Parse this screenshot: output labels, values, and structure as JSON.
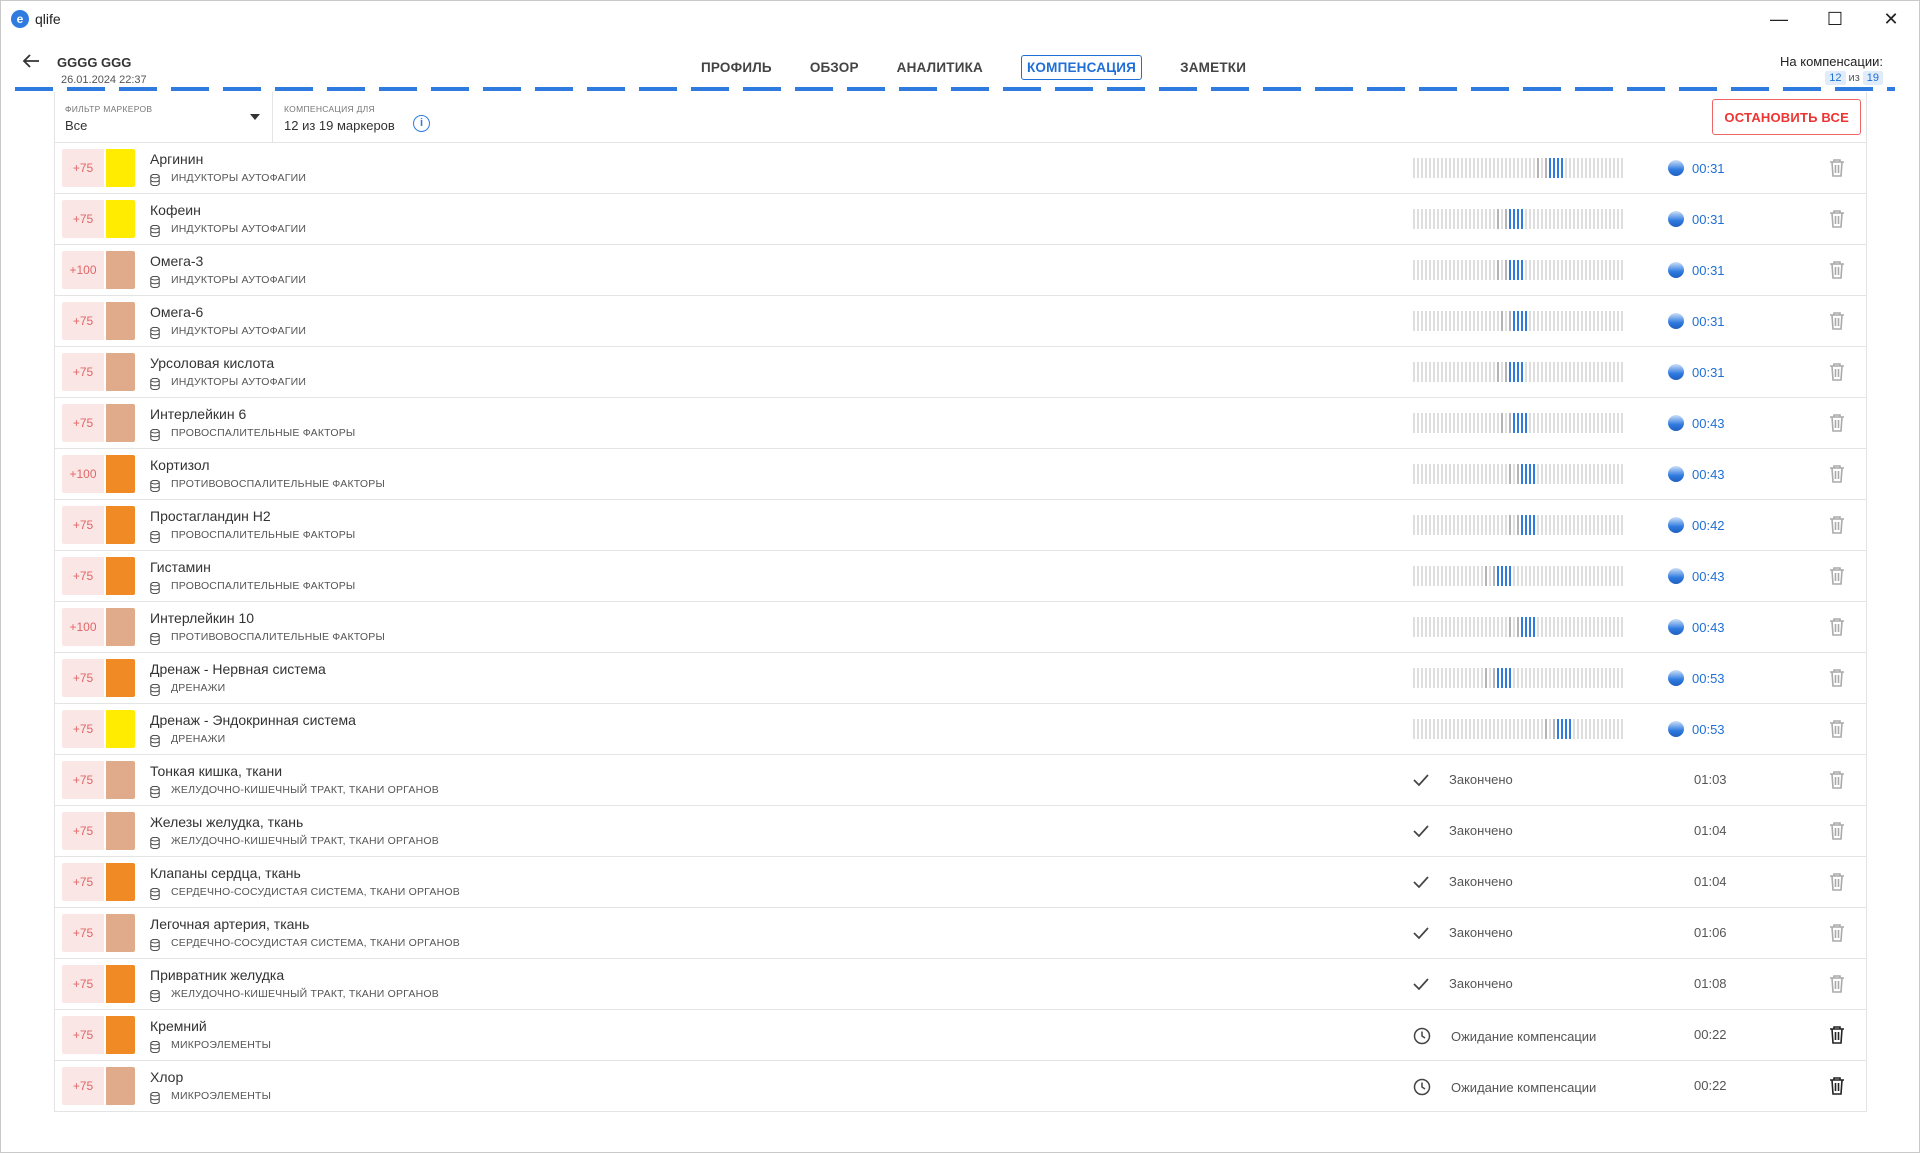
{
  "app": {
    "title": "qlife",
    "logo": "e"
  },
  "window": {
    "minimize": "—",
    "maximize": "☐",
    "close": "✕"
  },
  "patient": {
    "name": "GGGG GGG",
    "date": "26.01.2024 22:37"
  },
  "tabs": [
    {
      "label": "ПРОФИЛЬ",
      "active": false
    },
    {
      "label": "ОБЗОР",
      "active": false
    },
    {
      "label": "АНАЛИТИКА",
      "active": false
    },
    {
      "label": "КОМПЕНСАЦИЯ",
      "active": true
    },
    {
      "label": "ЗАМЕТКИ",
      "active": false
    }
  ],
  "compensation": {
    "label": "На компенсации:",
    "current": "12",
    "of": "из",
    "total": "19"
  },
  "filter": {
    "caption": "ФИЛЬТР МАРКЕРОВ",
    "value": "Все",
    "comp_caption": "КОМПЕНСАЦИЯ ДЛЯ",
    "comp_value": "12 из 19 маркеров",
    "stop_all": "ОСТАНОВИТЬ ВСЕ"
  },
  "colors": {
    "accent": "#1f6fd6",
    "yellow": "#ffec00",
    "tan": "#e0ab8a",
    "orange": "#f08a24",
    "stop": "#e33333"
  },
  "rows": [
    {
      "points": "+75",
      "color": "#ffec00",
      "name": "Аргинин",
      "category": "ИНДУКТОРЫ АУТОФАГИИ",
      "state": "running",
      "pos": 0.65,
      "time": "00:31"
    },
    {
      "points": "+75",
      "color": "#ffec00",
      "name": "Кофеин",
      "category": "ИНДУКТОРЫ АУТОФАГИИ",
      "state": "running",
      "pos": 0.45,
      "time": "00:31"
    },
    {
      "points": "+100",
      "color": "#e0ab8a",
      "name": "Омега-3",
      "category": "ИНДУКТОРЫ АУТОФАГИИ",
      "state": "running",
      "pos": 0.45,
      "time": "00:31"
    },
    {
      "points": "+75",
      "color": "#e0ab8a",
      "name": "Омега-6",
      "category": "ИНДУКТОРЫ АУТОФАГИИ",
      "state": "running",
      "pos": 0.48,
      "time": "00:31"
    },
    {
      "points": "+75",
      "color": "#e0ab8a",
      "name": "Урсоловая кислота",
      "category": "ИНДУКТОРЫ АУТОФАГИИ",
      "state": "running",
      "pos": 0.45,
      "time": "00:31"
    },
    {
      "points": "+75",
      "color": "#e0ab8a",
      "name": "Интерлейкин 6",
      "category": "ПРОВОСПАЛИТЕЛЬНЫЕ ФАКТОРЫ",
      "state": "running",
      "pos": 0.48,
      "time": "00:43"
    },
    {
      "points": "+100",
      "color": "#f08a24",
      "name": "Кортизол",
      "category": "ПРОТИВОВОСПАЛИТЕЛЬНЫЕ ФАКТОРЫ",
      "state": "running",
      "pos": 0.51,
      "time": "00:43"
    },
    {
      "points": "+75",
      "color": "#f08a24",
      "name": "Простагландин Н2",
      "category": "ПРОВОСПАЛИТЕЛЬНЫЕ ФАКТОРЫ",
      "state": "running",
      "pos": 0.51,
      "time": "00:42"
    },
    {
      "points": "+75",
      "color": "#f08a24",
      "name": "Гистамин",
      "category": "ПРОВОСПАЛИТЕЛЬНЫЕ ФАКТОРЫ",
      "state": "running",
      "pos": 0.4,
      "time": "00:43"
    },
    {
      "points": "+100",
      "color": "#e0ab8a",
      "name": "Интерлейкин 10",
      "category": "ПРОТИВОВОСПАЛИТЕЛЬНЫЕ ФАКТОРЫ",
      "state": "running",
      "pos": 0.51,
      "time": "00:43"
    },
    {
      "points": "+75",
      "color": "#f08a24",
      "name": "Дренаж - Нервная система",
      "category": "ДРЕНАЖИ",
      "state": "running",
      "pos": 0.4,
      "time": "00:53"
    },
    {
      "points": "+75",
      "color": "#ffec00",
      "name": "Дренаж - Эндокринная система",
      "category": "ДРЕНАЖИ",
      "state": "running",
      "pos": 0.67,
      "time": "00:53"
    },
    {
      "points": "+75",
      "color": "#e0ab8a",
      "name": "Тонкая кишка, ткани",
      "category": "ЖЕЛУДОЧНО-КИШЕЧНЫЙ ТРАКТ, ТКАНИ ОРГАНОВ",
      "state": "done",
      "status": "Закончено",
      "time": "01:03"
    },
    {
      "points": "+75",
      "color": "#e0ab8a",
      "name": "Железы желудка, ткань",
      "category": "ЖЕЛУДОЧНО-КИШЕЧНЫЙ ТРАКТ, ТКАНИ ОРГАНОВ",
      "state": "done",
      "status": "Закончено",
      "time": "01:04"
    },
    {
      "points": "+75",
      "color": "#f08a24",
      "name": "Клапаны сердца, ткань",
      "category": "СЕРДЕЧНО-СОСУДИСТАЯ СИСТЕМА, ТКАНИ ОРГАНОВ",
      "state": "done",
      "status": "Закончено",
      "time": "01:04"
    },
    {
      "points": "+75",
      "color": "#e0ab8a",
      "name": "Легочная артерия, ткань",
      "category": "СЕРДЕЧНО-СОСУДИСТАЯ СИСТЕМА, ТКАНИ ОРГАНОВ",
      "state": "done",
      "status": "Закончено",
      "time": "01:06"
    },
    {
      "points": "+75",
      "color": "#f08a24",
      "name": "Привратник желудка",
      "category": "ЖЕЛУДОЧНО-КИШЕЧНЫЙ ТРАКТ, ТКАНИ ОРГАНОВ",
      "state": "done",
      "status": "Закончено",
      "time": "01:08"
    },
    {
      "points": "+75",
      "color": "#f08a24",
      "name": "Кремний",
      "category": "МИКРОЭЛЕМЕНТЫ",
      "state": "waiting",
      "status": "Ожидание компенсации",
      "time": "00:22"
    },
    {
      "points": "+75",
      "color": "#e0ab8a",
      "name": "Хлор",
      "category": "МИКРОЭЛЕМЕНТЫ",
      "state": "waiting",
      "status": "Ожидание компенсации",
      "time": "00:22"
    }
  ]
}
